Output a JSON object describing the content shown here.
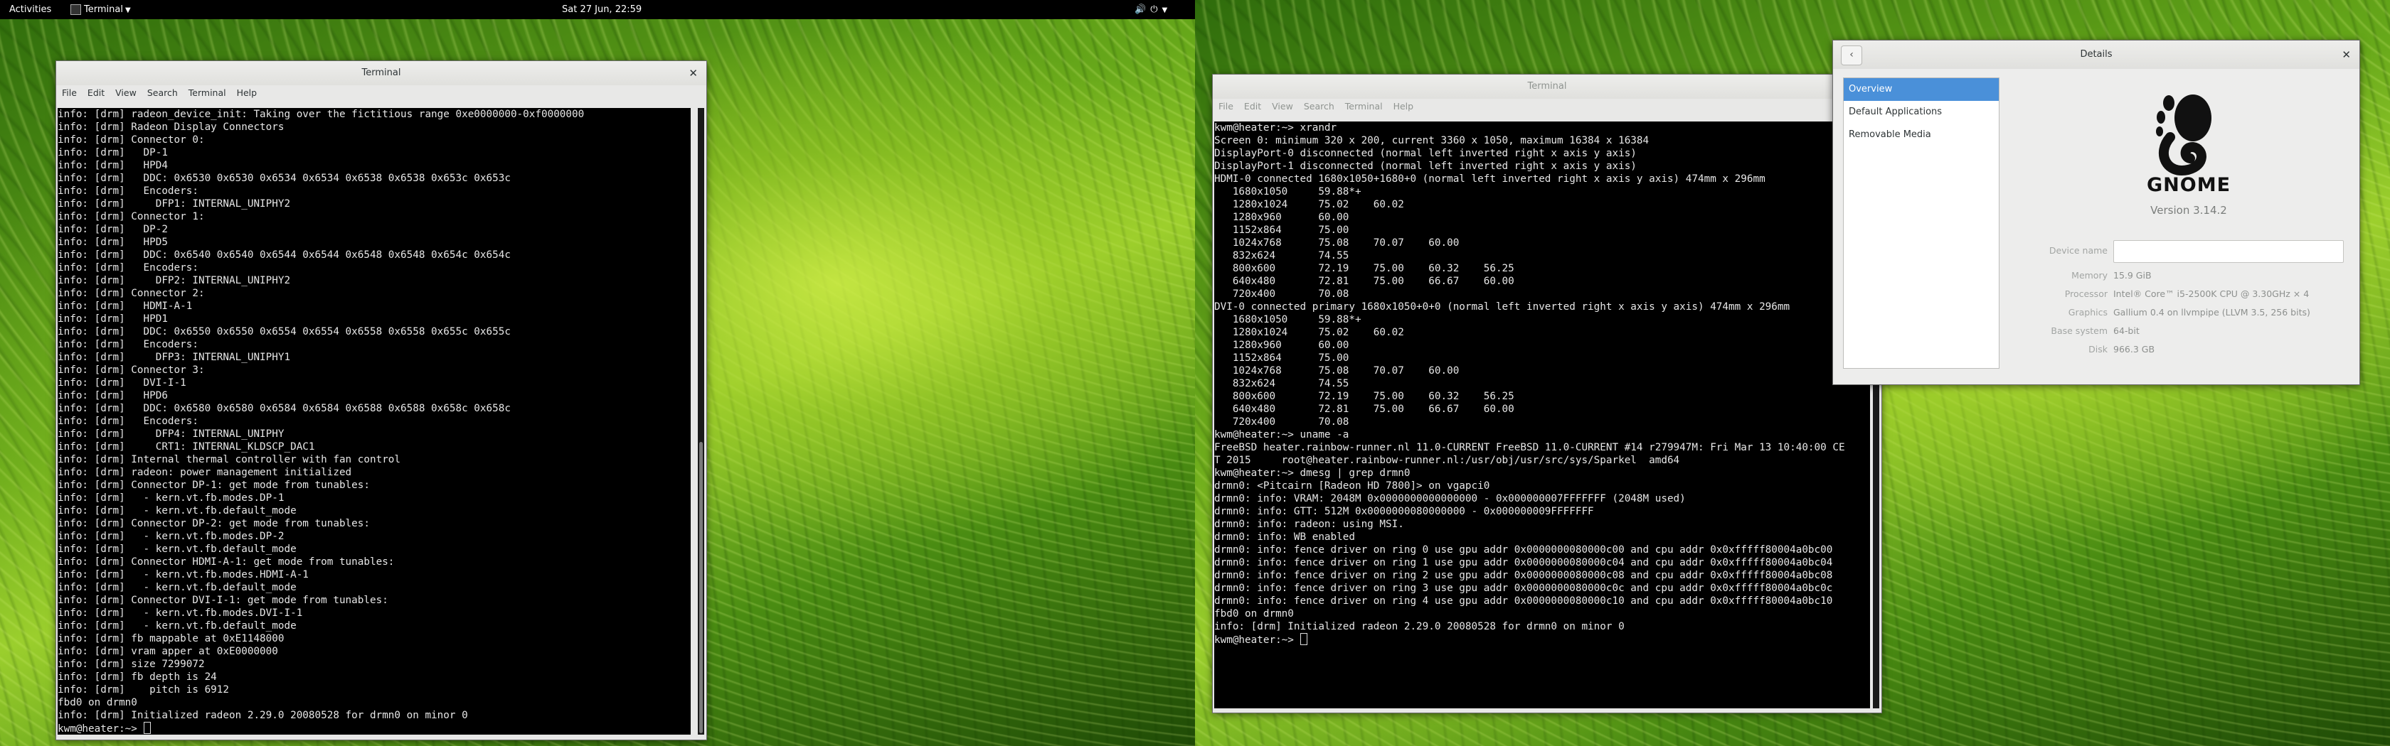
{
  "topbar": {
    "activities": "Activities",
    "app_menu": "Terminal",
    "clock": "Sat 27 Jun, 22:59",
    "icons": [
      "volume-icon",
      "power-icon",
      "caret-down-icon"
    ]
  },
  "left_terminal": {
    "title": "Terminal",
    "menu": [
      "File",
      "Edit",
      "View",
      "Search",
      "Terminal",
      "Help"
    ],
    "lines": [
      "info: [drm] radeon_device_init: Taking over the fictitious range 0xe0000000-0xf0000000",
      "info: [drm] Radeon Display Connectors",
      "info: [drm] Connector 0:",
      "info: [drm]   DP-1",
      "info: [drm]   HPD4",
      "info: [drm]   DDC: 0x6530 0x6530 0x6534 0x6534 0x6538 0x6538 0x653c 0x653c",
      "info: [drm]   Encoders:",
      "info: [drm]     DFP1: INTERNAL_UNIPHY2",
      "info: [drm] Connector 1:",
      "info: [drm]   DP-2",
      "info: [drm]   HPD5",
      "info: [drm]   DDC: 0x6540 0x6540 0x6544 0x6544 0x6548 0x6548 0x654c 0x654c",
      "info: [drm]   Encoders:",
      "info: [drm]     DFP2: INTERNAL_UNIPHY2",
      "info: [drm] Connector 2:",
      "info: [drm]   HDMI-A-1",
      "info: [drm]   HPD1",
      "info: [drm]   DDC: 0x6550 0x6550 0x6554 0x6554 0x6558 0x6558 0x655c 0x655c",
      "info: [drm]   Encoders:",
      "info: [drm]     DFP3: INTERNAL_UNIPHY1",
      "info: [drm] Connector 3:",
      "info: [drm]   DVI-I-1",
      "info: [drm]   HPD6",
      "info: [drm]   DDC: 0x6580 0x6580 0x6584 0x6584 0x6588 0x6588 0x658c 0x658c",
      "info: [drm]   Encoders:",
      "info: [drm]     DFP4: INTERNAL_UNIPHY",
      "info: [drm]     CRT1: INTERNAL_KLDSCP_DAC1",
      "info: [drm] Internal thermal controller with fan control",
      "info: [drm] radeon: power management initialized",
      "info: [drm] Connector DP-1: get mode from tunables:",
      "info: [drm]   - kern.vt.fb.modes.DP-1",
      "info: [drm]   - kern.vt.fb.default_mode",
      "info: [drm] Connector DP-2: get mode from tunables:",
      "info: [drm]   - kern.vt.fb.modes.DP-2",
      "info: [drm]   - kern.vt.fb.default_mode",
      "info: [drm] Connector HDMI-A-1: get mode from tunables:",
      "info: [drm]   - kern.vt.fb.modes.HDMI-A-1",
      "info: [drm]   - kern.vt.fb.default_mode",
      "info: [drm] Connector DVI-I-1: get mode from tunables:",
      "info: [drm]   - kern.vt.fb.modes.DVI-I-1",
      "info: [drm]   - kern.vt.fb.default_mode",
      "info: [drm] fb mappable at 0xE1148000",
      "info: [drm] vram apper at 0xE0000000",
      "info: [drm] size 7299072",
      "info: [drm] fb depth is 24",
      "info: [drm]    pitch is 6912",
      "fbd0 on drmn0",
      "info: [drm] Initialized radeon 2.29.0 20080528 for drmn0 on minor 0",
      "kwm@heater:~> "
    ]
  },
  "right_terminal": {
    "title": "Terminal",
    "menu": [
      "File",
      "Edit",
      "View",
      "Search",
      "Terminal",
      "Help"
    ],
    "lines": [
      "kwm@heater:~> xrandr",
      "Screen 0: minimum 320 x 200, current 3360 x 1050, maximum 16384 x 16384",
      "DisplayPort-0 disconnected (normal left inverted right x axis y axis)",
      "DisplayPort-1 disconnected (normal left inverted right x axis y axis)",
      "HDMI-0 connected 1680x1050+1680+0 (normal left inverted right x axis y axis) 474mm x 296mm",
      "   1680x1050     59.88*+",
      "   1280x1024     75.02    60.02",
      "   1280x960      60.00",
      "   1152x864      75.00",
      "   1024x768      75.08    70.07    60.00",
      "   832x624       74.55",
      "   800x600       72.19    75.00    60.32    56.25",
      "   640x480       72.81    75.00    66.67    60.00",
      "   720x400       70.08",
      "DVI-0 connected primary 1680x1050+0+0 (normal left inverted right x axis y axis) 474mm x 296mm",
      "   1680x1050     59.88*+",
      "   1280x1024     75.02    60.02",
      "   1280x960      60.00",
      "   1152x864      75.00",
      "   1024x768      75.08    70.07    60.00",
      "   832x624       74.55",
      "   800x600       72.19    75.00    60.32    56.25",
      "   640x480       72.81    75.00    66.67    60.00",
      "   720x400       70.08",
      "kwm@heater:~> uname -a",
      "FreeBSD heater.rainbow-runner.nl 11.0-CURRENT FreeBSD 11.0-CURRENT #14 r279947M: Fri Mar 13 10:40:00 CE",
      "T 2015     root@heater.rainbow-runner.nl:/usr/obj/usr/src/sys/Sparkel  amd64",
      "kwm@heater:~> dmesg | grep drmn0",
      "drmn0: <Pitcairn [Radeon HD 7800]> on vgapci0",
      "drmn0: info: VRAM: 2048M 0x0000000000000000 - 0x000000007FFFFFFF (2048M used)",
      "drmn0: info: GTT: 512M 0x0000000080000000 - 0x000000009FFFFFFF",
      "drmn0: info: radeon: using MSI.",
      "drmn0: info: WB enabled",
      "drmn0: info: fence driver on ring 0 use gpu addr 0x0000000080000c00 and cpu addr 0x0xfffff80004a0bc00",
      "drmn0: info: fence driver on ring 1 use gpu addr 0x0000000080000c04 and cpu addr 0x0xfffff80004a0bc04",
      "drmn0: info: fence driver on ring 2 use gpu addr 0x0000000080000c08 and cpu addr 0x0xfffff80004a0bc08",
      "drmn0: info: fence driver on ring 3 use gpu addr 0x0000000080000c0c and cpu addr 0x0xfffff80004a0bc0c",
      "drmn0: info: fence driver on ring 4 use gpu addr 0x0000000080000c10 and cpu addr 0x0xfffff80004a0bc10",
      "fbd0 on drmn0",
      "info: [drm] Initialized radeon 2.29.0 20080528 for drmn0 on minor 0",
      "kwm@heater:~> "
    ]
  },
  "details": {
    "title": "Details",
    "sidebar": [
      "Overview",
      "Default Applications",
      "Removable Media"
    ],
    "selected_index": 0,
    "logo_text": "GNOME",
    "version": "Version 3.14.2",
    "device_name_label": "Device name",
    "device_name_value": "",
    "rows": [
      {
        "label": "Memory",
        "value": "15.9 GiB"
      },
      {
        "label": "Processor",
        "value": "Intel® Core™ i5-2500K CPU @ 3.30GHz × 4"
      },
      {
        "label": "Graphics",
        "value": "Gallium 0.4 on llvmpipe (LLVM 3.5, 256 bits)"
      },
      {
        "label": "Base system",
        "value": "64-bit"
      },
      {
        "label": "Disk",
        "value": "966.3 GB"
      }
    ]
  },
  "colors": {
    "accent": "#4a90d9",
    "terminal_bg": "#000000",
    "terminal_fg": "#e6e6e6",
    "topbar_bg": "#000000"
  }
}
